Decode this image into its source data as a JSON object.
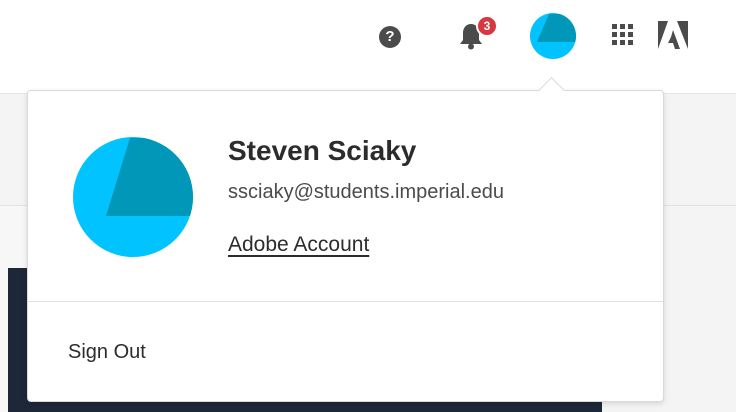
{
  "header": {
    "help_symbol": "?",
    "notifications": {
      "count": "3"
    },
    "icons": [
      "help-icon",
      "bell-icon",
      "avatar-icon",
      "apps-grid-icon",
      "adobe-logo-icon"
    ]
  },
  "account_menu": {
    "user_name": "Steven Sciaky",
    "email": "ssciaky@students.imperial.edu",
    "account_link": "Adobe Account",
    "sign_out": "Sign Out"
  },
  "colors": {
    "avatar_light": "#00c3ff",
    "avatar_dark": "#0097b8",
    "badge": "#d7373f",
    "icon_gray": "#4b4b4b",
    "text": "#2c2c2c",
    "dark_panel": "#1e2738"
  }
}
